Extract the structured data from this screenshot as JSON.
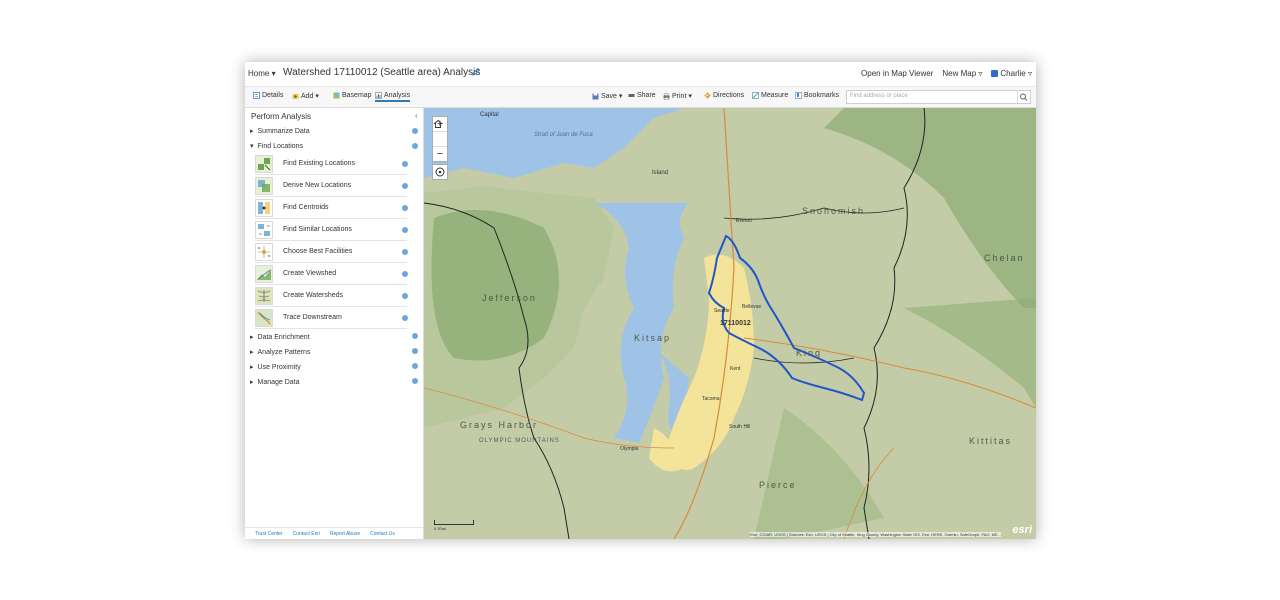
{
  "header": {
    "home_label": "Home ▾",
    "title": "Watershed 17110012 (Seattle area) Analysis",
    "open_map_viewer": "Open in Map Viewer",
    "new_map": "New Map ▿",
    "user": "Charlie ▿"
  },
  "toolbar": {
    "details": "Details",
    "add": "Add ▾",
    "basemap": "Basemap",
    "analysis": "Analysis",
    "save": "Save ▾",
    "share": "Share",
    "print": "Print ▾",
    "directions": "Directions",
    "measure": "Measure",
    "bookmarks": "Bookmarks",
    "search_placeholder": "Find address or place"
  },
  "panel": {
    "title": "Perform Analysis",
    "categories": [
      {
        "label": "Summarize Data"
      },
      {
        "label": "Find Locations"
      },
      {
        "label": "Data Enrichment"
      },
      {
        "label": "Analyze Patterns"
      },
      {
        "label": "Use Proximity"
      },
      {
        "label": "Manage Data"
      }
    ],
    "tools": [
      {
        "label": "Find Existing Locations"
      },
      {
        "label": "Derive New Locations"
      },
      {
        "label": "Find Centroids"
      },
      {
        "label": "Find Similar Locations"
      },
      {
        "label": "Choose Best Facilities"
      },
      {
        "label": "Create Viewshed"
      },
      {
        "label": "Create Watersheds"
      },
      {
        "label": "Trace Downstream"
      }
    ],
    "footer": [
      "Trust Center",
      "Contact Esri",
      "Report Abuse",
      "Contact Us"
    ]
  },
  "map": {
    "watershed_label": "17110012",
    "labels": {
      "snohomish": "Snohomish",
      "king": "King",
      "kitsap": "Kitsap",
      "chelan": "Chelan",
      "kittitas": "Kittitas",
      "pierce": "Pierce",
      "jefferson": "Jefferson",
      "grays_harbor": "Grays Harbor",
      "olympic": "OLYMPIC MOUNTAINS",
      "seattle": "Seattle",
      "bellevue": "Bellevue",
      "tacoma": "Tacoma",
      "olympia": "Olympia",
      "everett": "Everett",
      "capital": "Capital",
      "strait": "Strait of Juan de Fuca",
      "island": "Island",
      "kent": "Kent",
      "puyallup": "South Hill"
    },
    "attribution": "Esri, CGIAR, USGS | Sources: Esri, USGS | City of Seattle, King County, Washington State GIS, Esri, HERE, Garmin, SafeGraph, FAO, ME...",
    "logo": "esri",
    "scale": "0    20mi"
  },
  "colors": {
    "accent": "#2c7bb6",
    "watershed_outline": "#1f56c9",
    "water": "#9fc3e7",
    "terrain": "#bfc9a0",
    "urban": "#f3e49a"
  }
}
